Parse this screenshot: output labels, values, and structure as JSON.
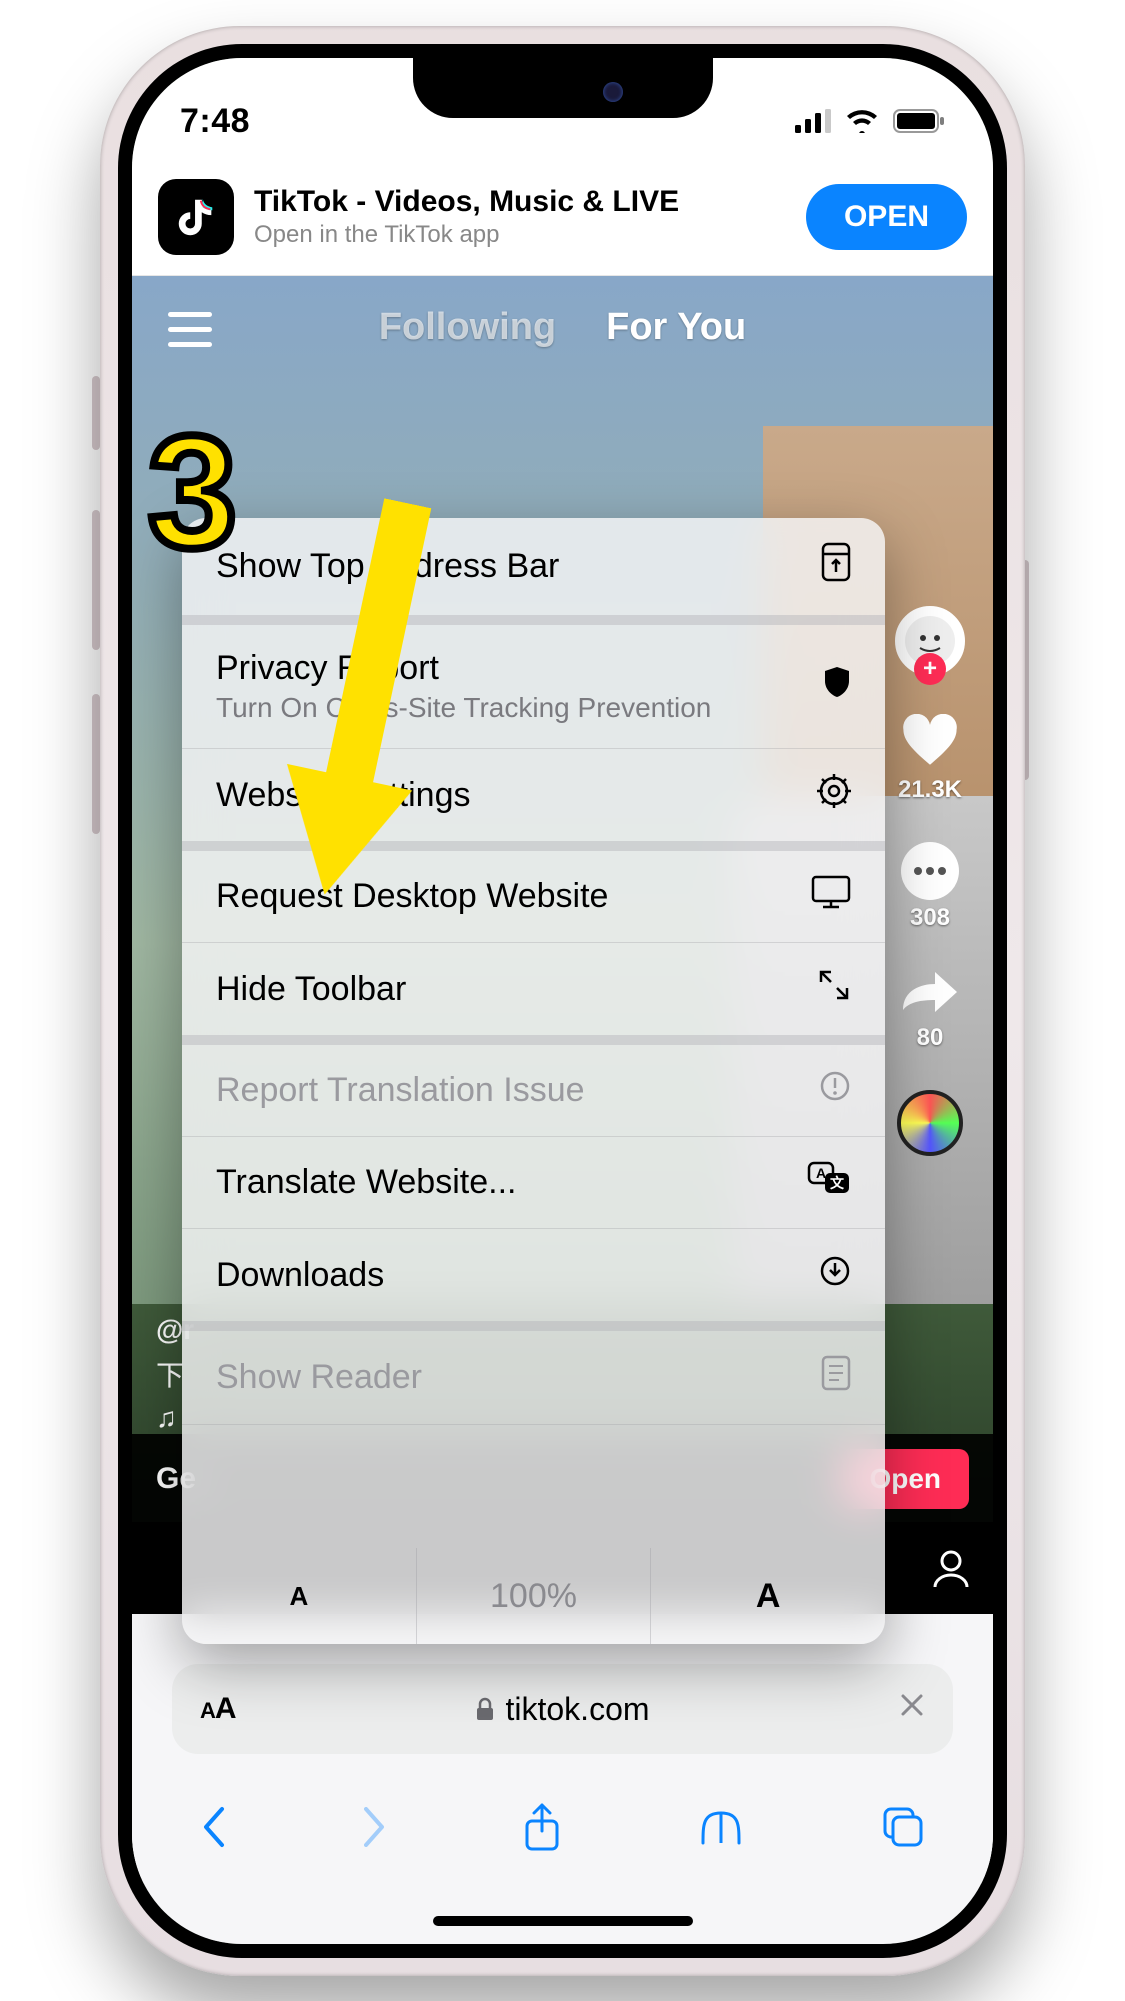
{
  "step_number": "3",
  "statusbar": {
    "time": "7:48"
  },
  "app_banner": {
    "title": "TikTok - Videos, Music & LIVE",
    "subtitle": "Open in the TikTok app",
    "button": "OPEN"
  },
  "tiktok": {
    "tab_following": "Following",
    "tab_foryou": "For You",
    "likes": "21.3K",
    "comments": "308",
    "shares": "80",
    "caption_user": "@r",
    "cta_text": "Ge",
    "cta_button": "Open"
  },
  "safari_menu": {
    "show_top_address_bar": "Show Top Address Bar",
    "privacy_report": "Privacy Report",
    "privacy_sub": "Turn On Cross-Site Tracking Prevention",
    "website_settings": "Website Settings",
    "request_desktop": "Request Desktop Website",
    "hide_toolbar": "Hide Toolbar",
    "report_translation": "Report Translation Issue",
    "translate_website": "Translate Website...",
    "downloads": "Downloads",
    "show_reader": "Show Reader",
    "zoom_level": "100%"
  },
  "urlbar": {
    "domain": "tiktok.com"
  }
}
